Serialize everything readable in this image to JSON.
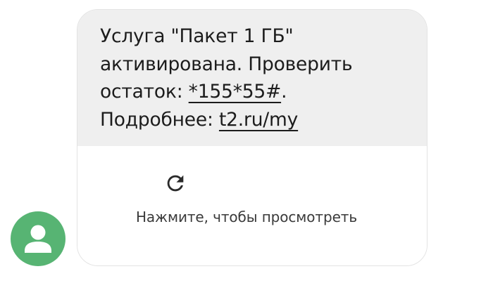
{
  "message": {
    "line1": "Услуга \"Пакет 1 ГБ\"",
    "line2": "активирована. Проверить",
    "line3_prefix": "остаток: ",
    "line3_code": "*155*55#",
    "line3_suffix": ".",
    "line4_prefix": "Подробнее: ",
    "line4_link": "t2.ru/my"
  },
  "action": {
    "label": "Нажмите, чтобы просмотреть",
    "icon": "refresh-icon"
  },
  "sender": {
    "icon": "person-icon"
  },
  "colors": {
    "avatar": "#57b473",
    "bubble": "#efefef"
  }
}
